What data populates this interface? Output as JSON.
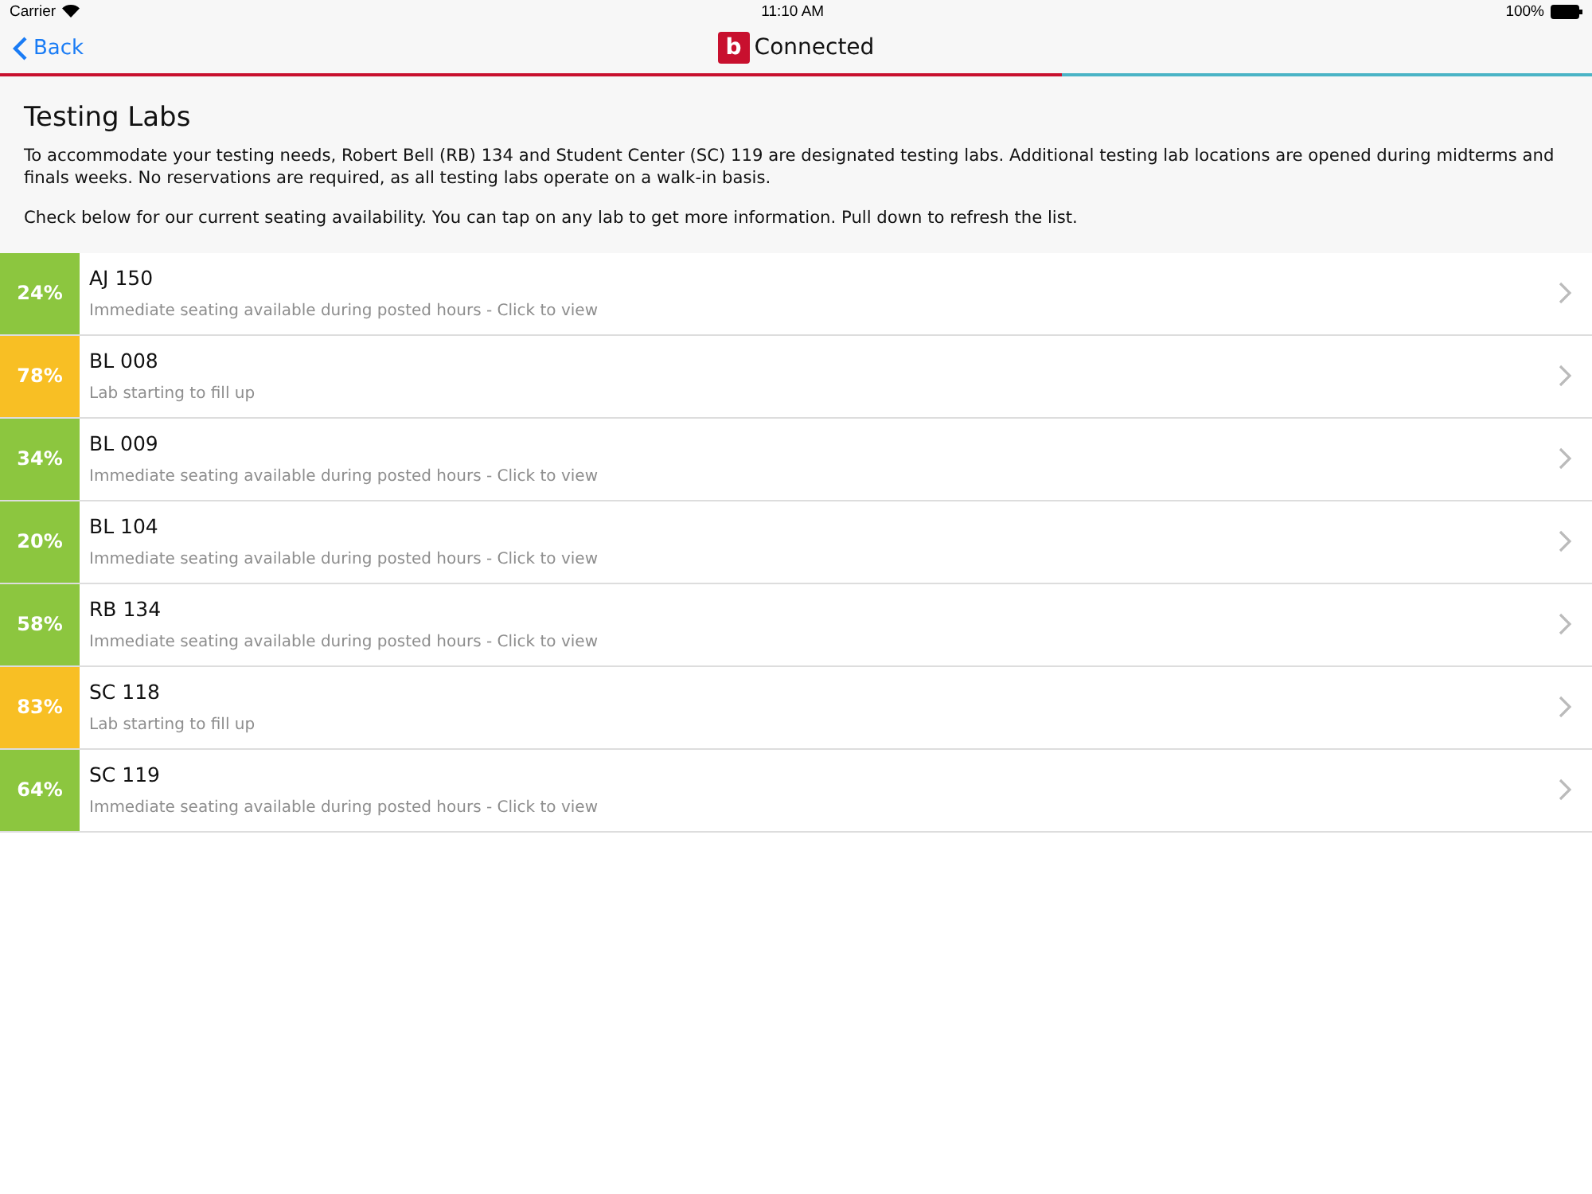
{
  "status_bar": {
    "carrier": "Carrier",
    "time": "11:10 AM",
    "battery": "100%"
  },
  "nav": {
    "back": "Back",
    "logo_letter": "b",
    "title": "Connected"
  },
  "intro": {
    "title": "Testing Labs",
    "paragraphs": [
      "To accommodate your testing needs, Robert Bell (RB) 134 and Student Center (SC) 119 are designated testing labs. Additional testing lab locations are opened during midterms and finals weeks. No reservations are required, as all testing labs operate on a walk-in basis.",
      "Check below for our current seating availability. You can tap on any lab to get more information. Pull down to refresh the list."
    ]
  },
  "labs": [
    {
      "percent": "24%",
      "color": "#8cc63f",
      "name": "AJ 150",
      "status": "Immediate seating available during posted hours - Click to view"
    },
    {
      "percent": "78%",
      "color": "#f8bf24",
      "name": "BL 008",
      "status": "Lab starting to fill up"
    },
    {
      "percent": "34%",
      "color": "#8cc63f",
      "name": "BL 009",
      "status": "Immediate seating available during posted hours - Click to view"
    },
    {
      "percent": "20%",
      "color": "#8cc63f",
      "name": "BL 104",
      "status": "Immediate seating available during posted hours - Click to view"
    },
    {
      "percent": "58%",
      "color": "#8cc63f",
      "name": "RB 134",
      "status": "Immediate seating available during posted hours - Click to view"
    },
    {
      "percent": "83%",
      "color": "#f8bf24",
      "name": "SC 118",
      "status": "Lab starting to fill up"
    },
    {
      "percent": "64%",
      "color": "#8cc63f",
      "name": "SC 119",
      "status": "Immediate seating available during posted hours - Click to view"
    }
  ]
}
